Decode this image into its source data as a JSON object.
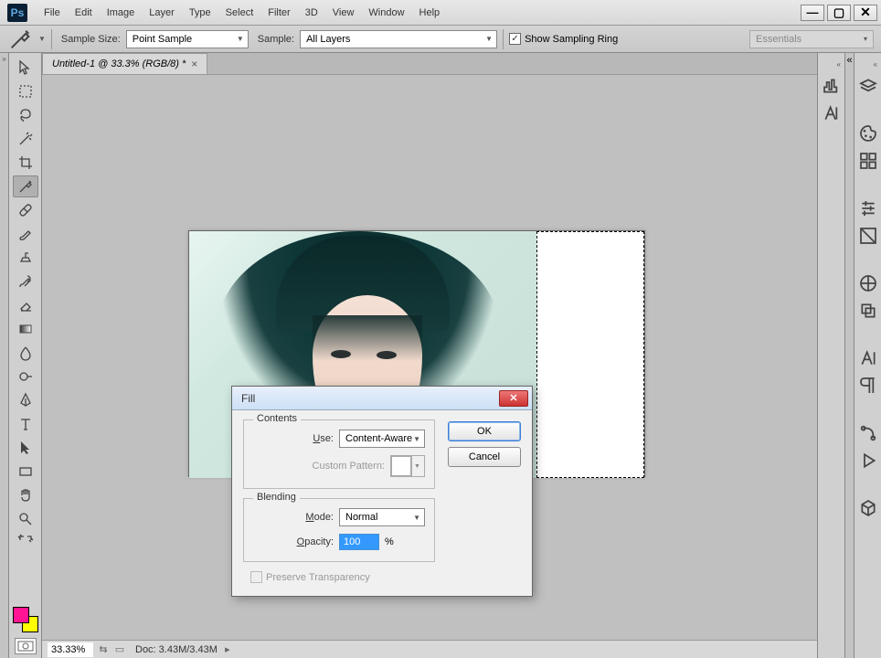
{
  "app": {
    "logo_text": "Ps"
  },
  "menu": [
    "File",
    "Edit",
    "Image",
    "Layer",
    "Type",
    "Select",
    "Filter",
    "3D",
    "View",
    "Window",
    "Help"
  ],
  "window_controls": {
    "minimize": "—",
    "maximize": "▢",
    "close": "✕"
  },
  "options_bar": {
    "sample_size_label": "Sample Size:",
    "sample_size_value": "Point Sample",
    "sample_label": "Sample:",
    "sample_value": "All Layers",
    "show_sampling_ring": "Show Sampling Ring",
    "workspace": "Essentials"
  },
  "document": {
    "tab_title": "Untitled-1 @ 33.3% (RGB/8) *"
  },
  "status": {
    "zoom": "33.33%",
    "doc_info": "Doc: 3.43M/3.43M"
  },
  "fill_dialog": {
    "title": "Fill",
    "contents_legend": "Contents",
    "use_label": "Use:",
    "use_value": "Content-Aware",
    "custom_pattern_label": "Custom Pattern:",
    "blending_legend": "Blending",
    "mode_label": "Mode:",
    "mode_value": "Normal",
    "opacity_label": "Opacity:",
    "opacity_value": "100",
    "opacity_suffix": "%",
    "preserve_label": "Preserve Transparency",
    "ok": "OK",
    "cancel": "Cancel"
  }
}
